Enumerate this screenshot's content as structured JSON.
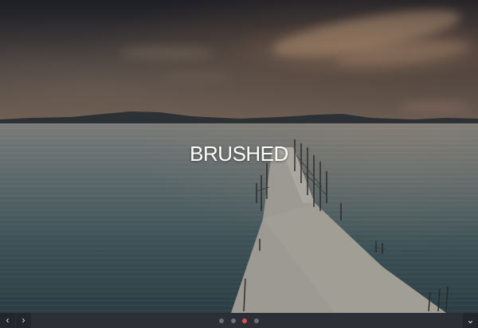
{
  "slide": {
    "title": "BRUSHED"
  },
  "navigation": {
    "prev_icon": "chevron-left-icon",
    "next_icon": "chevron-right-icon",
    "scroll_down_icon": "chevron-down-icon",
    "prev_glyph": "‹",
    "next_glyph": "›",
    "down_glyph": "⌄",
    "slide_count": 4,
    "active_index": 2,
    "dot_color": "#6d7077",
    "active_dot_color": "#d9534f"
  }
}
